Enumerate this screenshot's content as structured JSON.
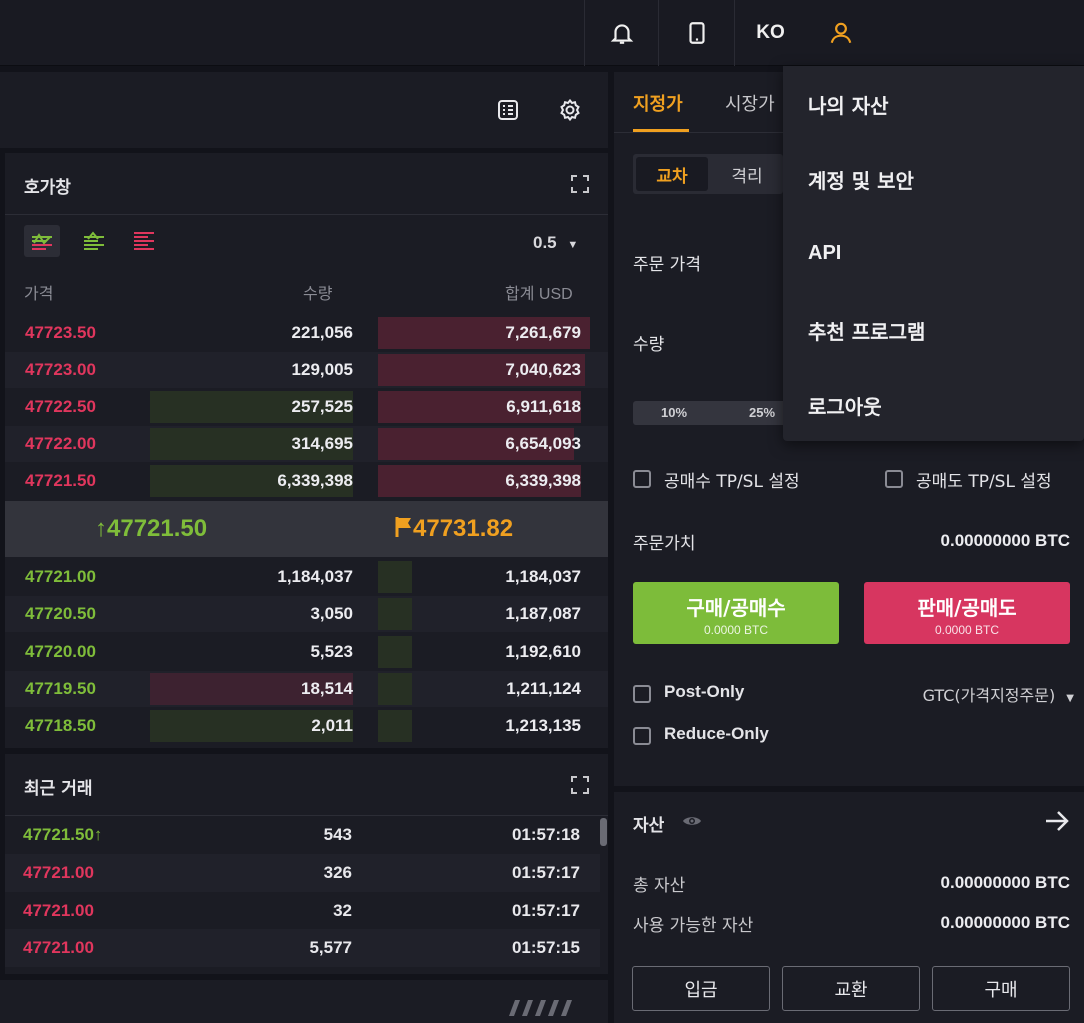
{
  "topbar": {
    "icons": [
      "bell-icon",
      "mobile-icon",
      "user-icon"
    ],
    "language": "KO",
    "accent": "#f0a020"
  },
  "toolbar_icons": [
    "layout-icon",
    "gear-icon"
  ],
  "orderbook": {
    "title": "호가창",
    "precision": "0.5",
    "headers": {
      "price": "가격",
      "qty": "수량",
      "total": "합계 USD"
    },
    "asks": [
      {
        "price": "47723.50",
        "qty": "221,056",
        "total": "7,261,679"
      },
      {
        "price": "47723.00",
        "qty": "129,005",
        "total": "7,040,623"
      },
      {
        "price": "47722.50",
        "qty": "257,525",
        "total": "6,911,618"
      },
      {
        "price": "47722.00",
        "qty": "314,695",
        "total": "6,654,093"
      },
      {
        "price": "47721.50",
        "qty": "6,339,398",
        "total": "6,339,398"
      }
    ],
    "last_price": "47721.50",
    "mark_price": "47731.82",
    "bids": [
      {
        "price": "47721.00",
        "qty": "1,184,037",
        "total": "1,184,037"
      },
      {
        "price": "47720.50",
        "qty": "3,050",
        "total": "1,187,087"
      },
      {
        "price": "47720.00",
        "qty": "5,523",
        "total": "1,192,610"
      },
      {
        "price": "47719.50",
        "qty": "18,514",
        "total": "1,211,124"
      },
      {
        "price": "47718.50",
        "qty": "2,011",
        "total": "1,213,135"
      }
    ]
  },
  "recent": {
    "title": "최근 거래",
    "trades": [
      {
        "price": "47721.50",
        "side": "buy",
        "qty": "543",
        "time": "01:57:18"
      },
      {
        "price": "47721.00",
        "side": "sell",
        "qty": "326",
        "time": "01:57:17"
      },
      {
        "price": "47721.00",
        "side": "sell",
        "qty": "32",
        "time": "01:57:17"
      },
      {
        "price": "47721.00",
        "side": "sell",
        "qty": "5,577",
        "time": "01:57:15"
      }
    ]
  },
  "order_form": {
    "tabs": [
      "지정가",
      "시장가"
    ],
    "margin_modes": [
      "교차",
      "격리"
    ],
    "price_label": "주문 가격",
    "qty_label": "수량",
    "pct": [
      "10%",
      "25%"
    ],
    "tpsl_long": "공매수 TP/SL 설정",
    "tpsl_short": "공매도 TP/SL 설정",
    "order_value_label": "주문가치",
    "order_value": "0.00000000 BTC",
    "buy_label": "구매/공매수",
    "buy_sub": "0.0000 BTC",
    "sell_label": "판매/공매도",
    "sell_sub": "0.0000 BTC",
    "post_only": "Post-Only",
    "reduce_only": "Reduce-Only",
    "tif": "GTC(가격지정주문)"
  },
  "assets": {
    "title": "자산",
    "total_label": "총 자산",
    "total": "0.00000000 BTC",
    "avail_label": "사용 가능한 자산",
    "avail": "0.00000000 BTC",
    "buttons": [
      "입금",
      "교환",
      "구매"
    ]
  },
  "user_menu": {
    "items": [
      "나의 자산",
      "계정 및 보안",
      "API",
      "추천 프로그램",
      "로그아웃"
    ]
  }
}
